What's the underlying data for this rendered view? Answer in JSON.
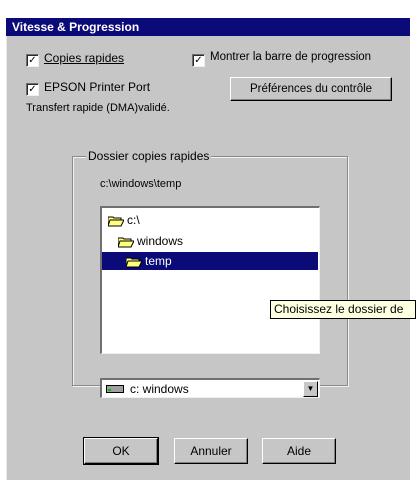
{
  "window": {
    "title": "Vitesse & Progression"
  },
  "options": {
    "fast_copies": {
      "label": "Copies rapides",
      "checked": true,
      "check_glyph": "✓"
    },
    "show_progress": {
      "label": "Montrer la barre de progression",
      "checked": true,
      "check_glyph": "✓"
    },
    "epson_port": {
      "label": "EPSON Printer Port",
      "checked": true,
      "check_glyph": "✓"
    },
    "dma_note": "Transfert rapide (DMA)validé."
  },
  "buttons": {
    "monitor_prefs": "Préférences du contrôle",
    "ok": "OK",
    "cancel": "Annuler",
    "help": "Aide"
  },
  "folder_group": {
    "legend": "Dossier copies rapides",
    "current_path": "c:\\windows\\temp",
    "tree": [
      {
        "label": "c:\\",
        "icon": "open-folder-icon",
        "selected": false
      },
      {
        "label": "windows",
        "icon": "open-folder-icon",
        "selected": false
      },
      {
        "label": "temp",
        "icon": "open-folder-icon",
        "selected": true
      }
    ],
    "drive_select": {
      "value": "c: windows",
      "icon": "drive-icon"
    }
  },
  "tooltip": "Choisissez le dossier de",
  "colors": {
    "title_bar": "#0a0a78",
    "dialog_face": "#c6c6c6",
    "selection": "#0a0a78",
    "tooltip_bg": "#ffffe1"
  }
}
